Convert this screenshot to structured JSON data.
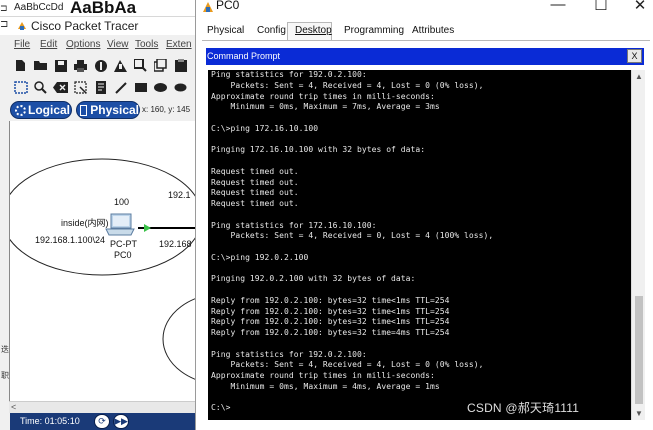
{
  "word_strip": {
    "left_glyph": "⊐",
    "style_sample_small": "AaBbCcDd",
    "style_sample_big": "AaBbAa"
  },
  "packet_tracer": {
    "title": "Cisco Packet Tracer",
    "edge_glyph": "⊐",
    "menu": [
      "File",
      "Edit",
      "Options",
      "View",
      "Tools",
      "Exten"
    ],
    "toolbar1_icons": [
      "new-file-icon",
      "open-folder-icon",
      "save-icon",
      "print-icon",
      "activity-wizard-icon",
      "network-info-icon",
      "zoom-icon",
      "copy-icon"
    ],
    "toolbar2_icons": [
      "select-icon",
      "search-icon",
      "delete-icon",
      "resize-icon",
      "note-icon",
      "draw-line-icon",
      "rectangle-icon",
      "ellipse-icon"
    ],
    "logical_label": "Logical",
    "physical_label": "Physical",
    "coords": "x: 160, y: 145",
    "side_glyphs": [
      "迭",
      "职"
    ],
    "time": "Time: 01:05:10",
    "canvas": {
      "label_100": "100",
      "label_192_top": "192.1",
      "label_inside": "inside(内网)",
      "label_ip": "192.168.1.100\\24",
      "label_device": "PC-PT",
      "label_pc0": "PC0",
      "label_192_right": "192.168"
    },
    "accent": "#1d4fa6"
  },
  "pc_window": {
    "title": "PC0",
    "controls": [
      "—",
      "☐",
      "✕"
    ],
    "tabs": [
      {
        "label": "Physical",
        "active": false
      },
      {
        "label": "Config",
        "active": false
      },
      {
        "label": "Desktop",
        "active": true
      },
      {
        "label": "Programming",
        "active": false
      },
      {
        "label": "Attributes",
        "active": false
      }
    ],
    "cmd_title": "Command Prompt",
    "cmd_close": "X",
    "cmd_header_color": "#0a2bd6",
    "terminal_lines": [
      "Ping statistics for 192.0.2.100:",
      "    Packets: Sent = 4, Received = 4, Lost = 0 (0% loss),",
      "Approximate round trip times in milli-seconds:",
      "    Minimum = 0ms, Maximum = 7ms, Average = 3ms",
      "",
      "C:\\>ping 172.16.10.100",
      "",
      "Pinging 172.16.10.100 with 32 bytes of data:",
      "",
      "Request timed out.",
      "Request timed out.",
      "Request timed out.",
      "Request timed out.",
      "",
      "Ping statistics for 172.16.10.100:",
      "    Packets: Sent = 4, Received = 0, Lost = 4 (100% loss),",
      "",
      "C:\\>ping 192.0.2.100",
      "",
      "Pinging 192.0.2.100 with 32 bytes of data:",
      "",
      "Reply from 192.0.2.100: bytes=32 time<1ms TTL=254",
      "Reply from 192.0.2.100: bytes=32 time<1ms TTL=254",
      "Reply from 192.0.2.100: bytes=32 time<1ms TTL=254",
      "Reply from 192.0.2.100: bytes=32 time=4ms TTL=254",
      "",
      "Ping statistics for 192.0.2.100:",
      "    Packets: Sent = 4, Received = 4, Lost = 0 (0% loss),",
      "Approximate round trip times in milli-seconds:",
      "    Minimum = 0ms, Maximum = 4ms, Average = 1ms",
      "",
      "C:\\>"
    ]
  },
  "watermark": "CSDN @郝天琦1111"
}
